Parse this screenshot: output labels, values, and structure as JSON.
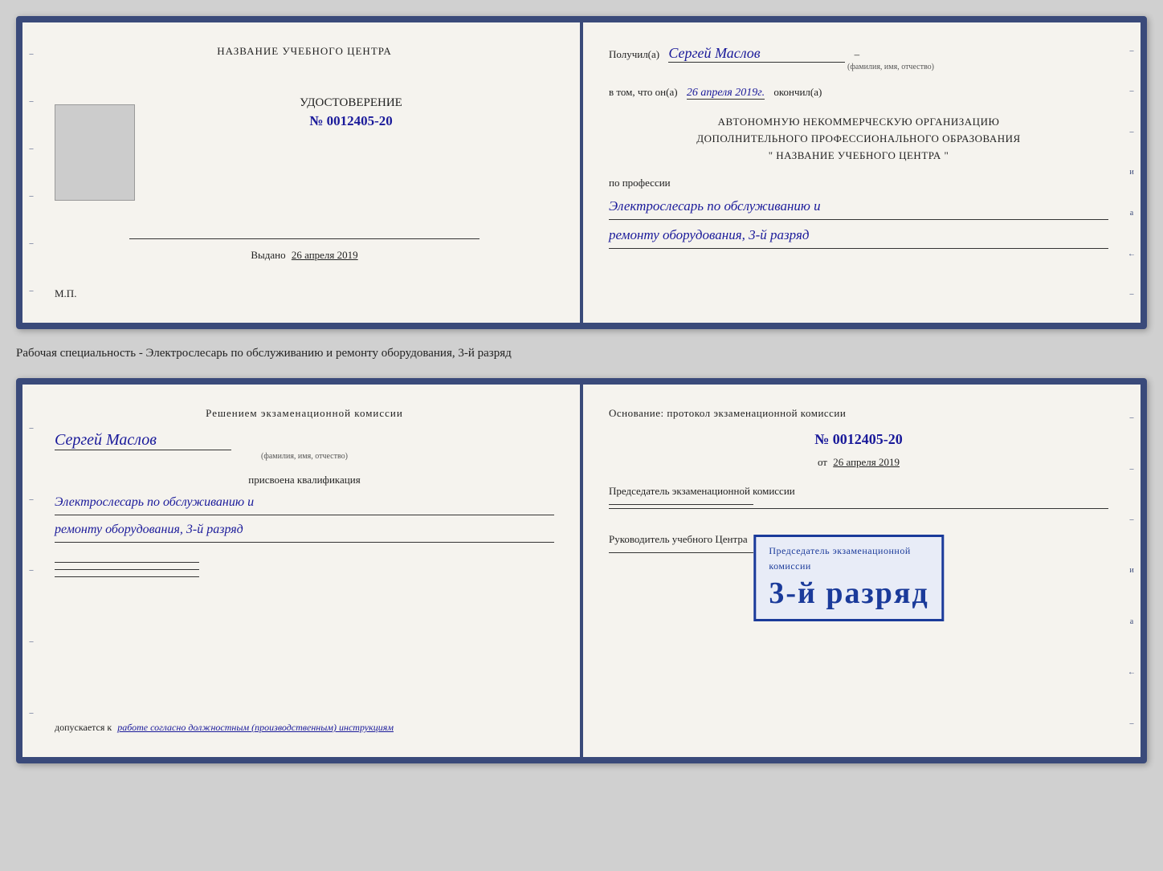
{
  "doc1": {
    "left": {
      "top_title": "НАЗВАНИЕ УЧЕБНОГО ЦЕНТРА",
      "photo_alt": "фото",
      "udost_title": "УДОСТОВЕРЕНИЕ",
      "udost_number": "№ 0012405-20",
      "vydano_label": "Выдано",
      "vydano_date": "26 апреля 2019",
      "mp_label": "М.П."
    },
    "right": {
      "poluchil_label": "Получил(а)",
      "poluchil_name": "Сергей Маслов",
      "fio_sublabel": "(фамилия, имя, отчество)",
      "dash": "–",
      "vtom_label": "в том, что он(а)",
      "vtom_date": "26 апреля 2019г.",
      "okonchil_label": "окончил(а)",
      "org_line1": "АВТОНОМНУЮ НЕКОММЕРЧЕСКУЮ ОРГАНИЗАЦИЮ",
      "org_line2": "ДОПОЛНИТЕЛЬНОГО ПРОФЕССИОНАЛЬНОГО ОБРАЗОВАНИЯ",
      "org_line3": "\"   НАЗВАНИЕ УЧЕБНОГО ЦЕНТРА   \"",
      "po_professii_label": "по профессии",
      "profession_line1": "Электрослесарь по обслуживанию и",
      "profession_line2": "ремонту оборудования, 3-й разряд"
    }
  },
  "between_label": "Рабочая специальность - Электрослесарь по обслуживанию и ремонту оборудования, 3-й разряд",
  "doc2": {
    "left": {
      "commission_title": "Решением экзаменационной комиссии",
      "name": "Сергей Маслов",
      "fio_sublabel": "(фамилия, имя, отчество)",
      "prisvoena_label": "присвоена квалификация",
      "qualification_line1": "Электрослесарь по обслуживанию и",
      "qualification_line2": "ремонту оборудования, 3-й разряд",
      "dopuskaetsya_label": "допускается к",
      "dopuskaetsya_text": "работе согласно должностным (производственным) инструкциям"
    },
    "right": {
      "osnovanie_label": "Основание: протокол экзаменационной комиссии",
      "number_label": "№  0012405-20",
      "ot_label": "от",
      "ot_date": "26 апреля 2019",
      "predsedatel_label": "Председатель экзаменационной комиссии",
      "rukovoditel_label": "Руководитель учебного Центра"
    },
    "stamp": {
      "line1": "Председатель экзаменационной",
      "line2": "комиссии",
      "main_text": "3-й разряд"
    }
  },
  "side_chars": [
    "–",
    "–",
    "–",
    "и",
    "а",
    "←",
    "–",
    "–",
    "–",
    "–"
  ],
  "icons": {}
}
